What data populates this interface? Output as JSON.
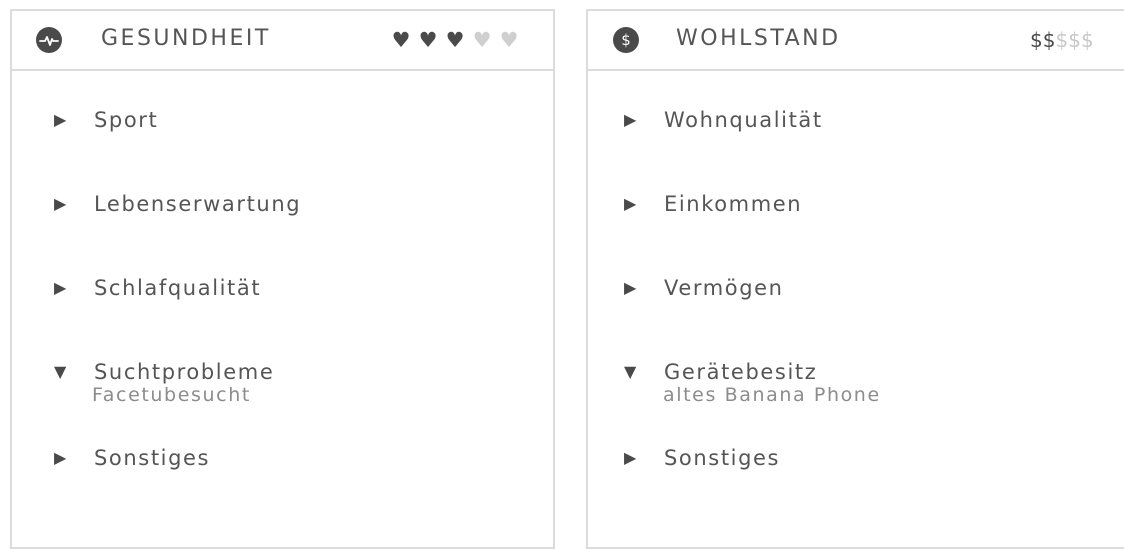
{
  "panels": {
    "health": {
      "title": "GESUNDHEIT",
      "icon": "heartbeat-icon",
      "rating": {
        "filled": 3,
        "total": 5,
        "glyph": "♥"
      },
      "items": [
        {
          "label": "Sport",
          "expanded": false
        },
        {
          "label": "Lebenserwartung",
          "expanded": false
        },
        {
          "label": "Schlafqualität",
          "expanded": false
        },
        {
          "label": "Suchtprobleme",
          "expanded": true,
          "value": "Facetubesucht"
        },
        {
          "label": "Sonstiges",
          "expanded": false
        }
      ]
    },
    "wealth": {
      "title": "WOHLSTAND",
      "icon": "dollar-icon",
      "icon_glyph": "$",
      "rating": {
        "filled": 2,
        "total": 5,
        "glyph": "$"
      },
      "items": [
        {
          "label": "Wohnqualität",
          "expanded": false
        },
        {
          "label": "Einkommen",
          "expanded": false
        },
        {
          "label": "Vermögen",
          "expanded": false
        },
        {
          "label": "Gerätebesitz",
          "expanded": true,
          "value": "altes Banana Phone"
        },
        {
          "label": "Sonstiges",
          "expanded": false
        }
      ]
    }
  },
  "glyphs": {
    "collapsed": "▶",
    "expanded": "▼"
  },
  "colors": {
    "border": "#dcdcdc",
    "icon_bg": "#4a4a4a",
    "rating_on": "#4a4a4a",
    "rating_off": "#cfcfcf",
    "text": "#555555",
    "subtext": "#8c8c8c"
  }
}
